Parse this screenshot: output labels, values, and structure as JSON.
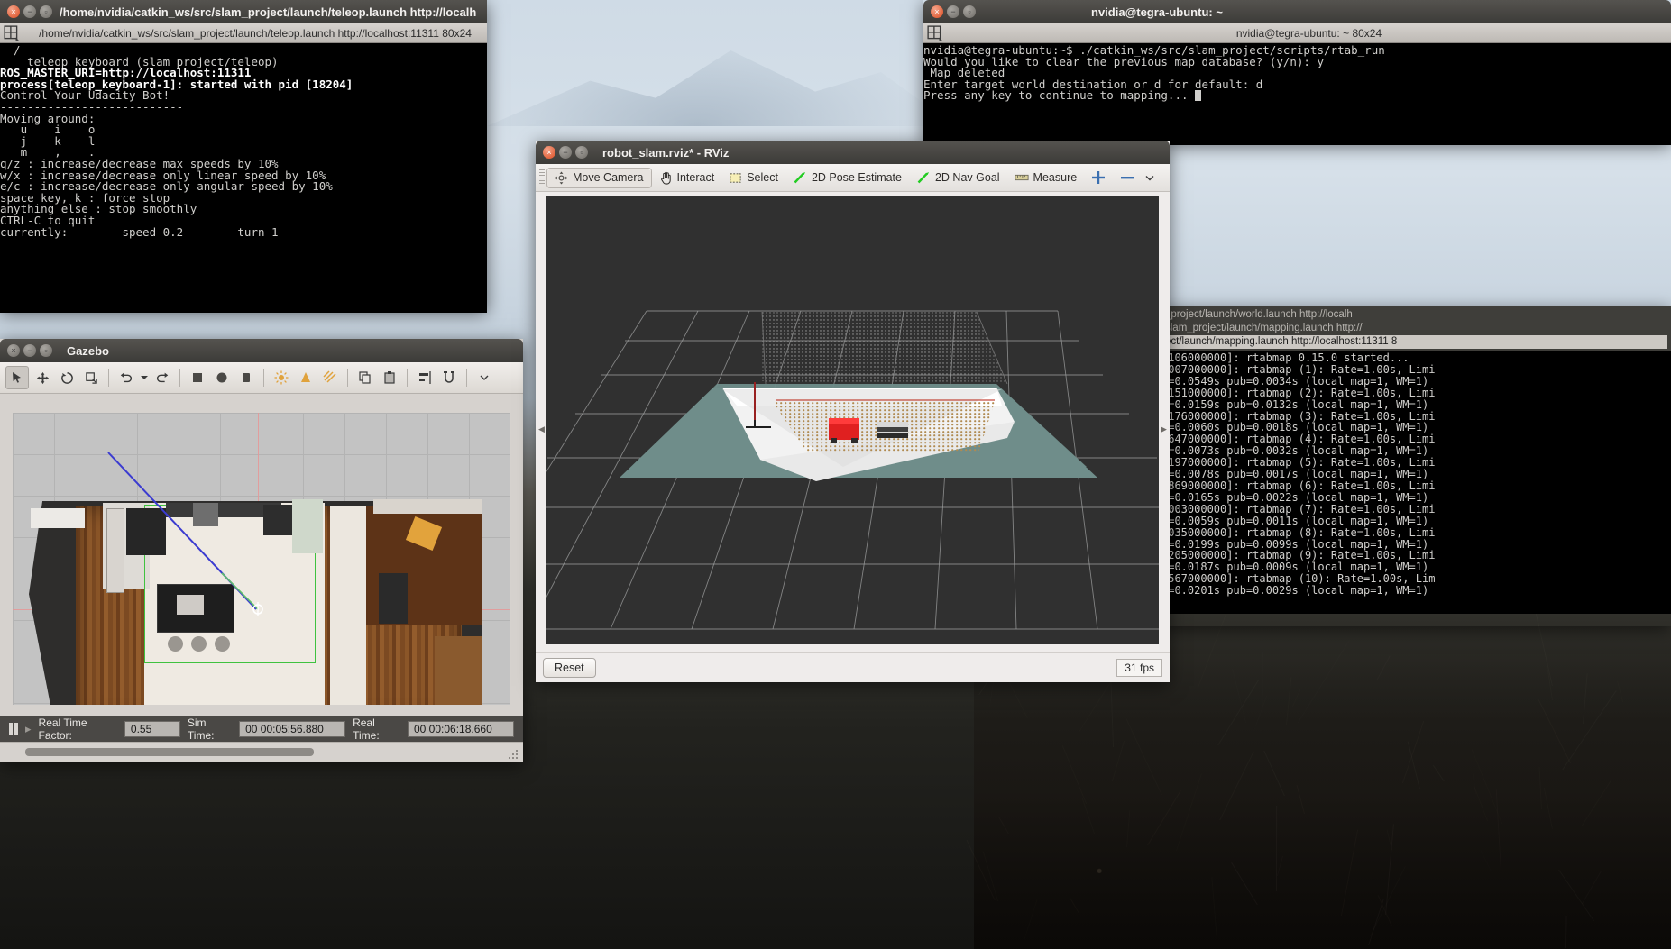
{
  "desktop": {
    "background": "#1b1b18"
  },
  "terminals": {
    "teleop": {
      "title": "/home/nvidia/catkin_ws/src/slam_project/launch/teleop.launch http://localh",
      "menubar_title": "/home/nvidia/catkin_ws/src/slam_project/launch/teleop.launch http://localhost:11311 80x24",
      "lines": [
        "  /",
        "    teleop_keyboard (slam_project/teleop)",
        "",
        "ROS_MASTER_URI=http://localhost:11311",
        "",
        "process[teleop_keyboard-1]: started with pid [18204]",
        "",
        "Control Your Udacity Bot!",
        "---------------------------",
        "Moving around:",
        "   u    i    o",
        "   j    k    l",
        "   m    ,    .",
        "",
        "q/z : increase/decrease max speeds by 10%",
        "w/x : increase/decrease only linear speed by 10%",
        "e/c : increase/decrease only angular speed by 10%",
        "space key, k : force stop",
        "anything else : stop smoothly",
        "",
        "CTRL-C to quit",
        "",
        "currently:\tspeed 0.2\tturn 1"
      ],
      "bold_line_indices": [
        3,
        5
      ]
    },
    "rtab": {
      "title": "nvidia@tegra-ubuntu: ~",
      "menubar_title": "nvidia@tegra-ubuntu: ~ 80x24",
      "lines": [
        "nvidia@tegra-ubuntu:~$ ./catkin_ws/src/slam_project/scripts/rtab_run",
        "",
        "Would you like to clear the previous map database? (y/n): y",
        "",
        " Map deleted",
        "",
        "Enter target world destination or d for default: d",
        "",
        "Press any key to continue to mapping... "
      ],
      "cursor_on_last_line": true
    },
    "log": {
      "stack_titles": [
        "_project/launch/world.launch http://localh",
        "slam_project/launch/mapping.launch http://",
        "ect/launch/mapping.launch http://localhost:11311 8"
      ],
      "selected_stack_index": 2,
      "lines": [
        ".106000000]: rtabmap 0.15.0 started...",
        ".007000000]: rtabmap (1): Rate=1.00s, Limi",
        "e=0.0549s pub=0.0034s (local map=1, WM=1)",
        ".151000000]: rtabmap (2): Rate=1.00s, Limi",
        "e=0.0159s pub=0.0132s (local map=1, WM=1)",
        ".176000000]: rtabmap (3): Rate=1.00s, Limi",
        "e=0.0060s pub=0.0018s (local map=1, WM=1)",
        ".647000000]: rtabmap (4): Rate=1.00s, Limi",
        "e=0.0073s pub=0.0032s (local map=1, WM=1)",
        ".197000000]: rtabmap (5): Rate=1.00s, Limi",
        "e=0.0078s pub=0.0017s (local map=1, WM=1)",
        ".869000000]: rtabmap (6): Rate=1.00s, Limi",
        "e=0.0165s pub=0.0022s (local map=1, WM=1)",
        ".003000000]: rtabmap (7): Rate=1.00s, Limi",
        "e=0.0059s pub=0.0011s (local map=1, WM=1)",
        ".035000000]: rtabmap (8): Rate=1.00s, Limi",
        "e=0.0199s pub=0.0099s (local map=1, WM=1)",
        ".205000000]: rtabmap (9): Rate=1.00s, Limi",
        "e=0.0187s pub=0.0009s (local map=1, WM=1)",
        ".567000000]: rtabmap (10): Rate=1.00s, Lim",
        "e=0.0201s pub=0.0029s (local map=1, WM=1)"
      ]
    }
  },
  "gazebo": {
    "title": "Gazebo",
    "toolbar_icons": [
      "select-arrow-icon",
      "translate-icon",
      "rotate-icon",
      "scale-icon",
      "undo-icon",
      "redo-icon",
      "box-icon",
      "sphere-icon",
      "cylinder-icon",
      "point-light-icon",
      "spot-light-icon",
      "directional-light-icon",
      "copy-icon",
      "paste-icon",
      "align-icon",
      "snap-icon",
      "more-icon"
    ],
    "status": {
      "pause_icon": "pause-icon",
      "step_icon": "step-icon",
      "real_time_factor_label": "Real Time Factor:",
      "real_time_factor_value": "0.55",
      "sim_time_label": "Sim Time:",
      "sim_time_value": "00 00:05:56.880",
      "real_time_label": "Real Time:",
      "real_time_value": "00 00:06:18.660"
    }
  },
  "rviz": {
    "title": "robot_slam.rviz* - RViz",
    "tools": [
      {
        "label": "Move Camera",
        "icon": "move-camera-icon",
        "active": true
      },
      {
        "label": "Interact",
        "icon": "hand-icon",
        "active": false
      },
      {
        "label": "Select",
        "icon": "select-rect-icon",
        "active": false
      },
      {
        "label": "2D Pose Estimate",
        "icon": "pose-arrow-icon",
        "active": false
      },
      {
        "label": "2D Nav Goal",
        "icon": "nav-goal-arrow-icon",
        "active": false
      },
      {
        "label": "Measure",
        "icon": "measure-icon",
        "active": false
      },
      {
        "label": "",
        "icon": "publish-point-icon",
        "active": false
      },
      {
        "label": "",
        "icon": "minus-icon",
        "active": false
      },
      {
        "label": "",
        "icon": "chevron-down-icon",
        "active": false
      }
    ],
    "reset_label": "Reset",
    "fps_label": "31 fps",
    "scene": {
      "grid_color": "#bebebe",
      "background_color": "#303030",
      "free_space_color": "#6f8d8a",
      "occupied_color": "#ffffff",
      "robot_color": "#e02020",
      "point_cloud_color": "#b08a50"
    }
  }
}
